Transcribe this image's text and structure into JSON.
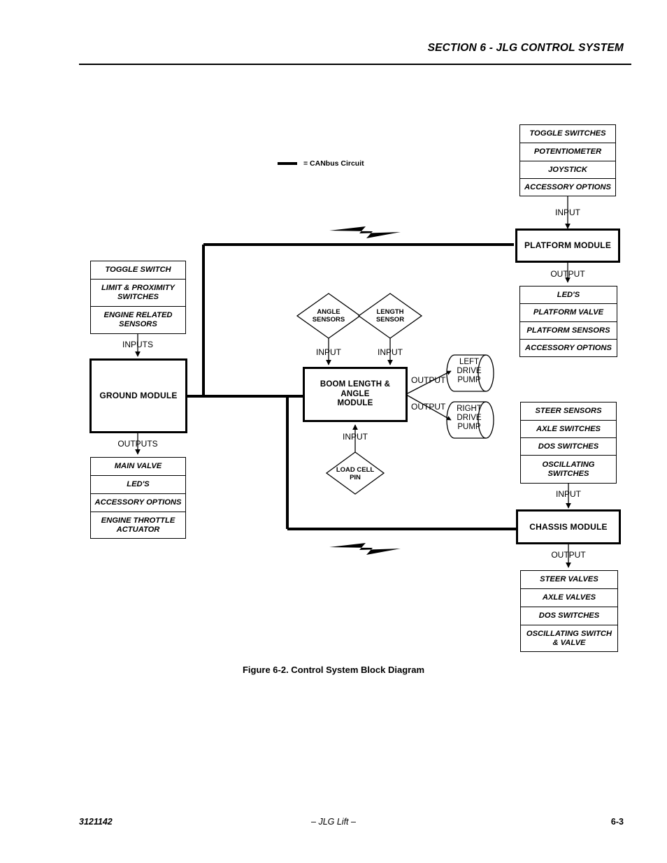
{
  "header": {
    "section_title": "SECTION 6 - JLG CONTROL SYSTEM"
  },
  "footer": {
    "doc_number": "3121142",
    "center": "– JLG Lift –",
    "page_number": "6-3"
  },
  "caption": {
    "text": "Figure 6-2.  Control System Block Diagram"
  },
  "legend": {
    "label": "= CANbus Circuit"
  },
  "flow_labels": {
    "platform_input": "INPUT",
    "platform_output": "OUTPUT",
    "ground_inputs": "INPUTS",
    "ground_outputs": "OUTPUTS",
    "angle_input": "INPUT",
    "length_input": "INPUT",
    "loadcell_input": "INPUT",
    "left_pump_output": "OUTPUT",
    "right_pump_output": "OUTPUT",
    "chassis_input": "INPUT",
    "chassis_output": "OUTPUT"
  },
  "modules": {
    "platform": "PLATFORM MODULE",
    "ground": "GROUND MODULE",
    "boom": "BOOM LENGTH & ANGLE\nMODULE",
    "boom_line1": "BOOM LENGTH & ANGLE",
    "boom_line2": "MODULE",
    "chassis": "CHASSIS MODULE"
  },
  "diamonds": {
    "angle_line1": "ANGLE",
    "angle_line2": "SENSORS",
    "length_line1": "LENGTH",
    "length_line2": "SENSOR",
    "loadcell_line1": "LOAD CELL",
    "loadcell_line2": "PIN"
  },
  "pumps": {
    "left_line1": "LEFT",
    "left_line2": "DRIVE",
    "left_line3": "PUMP",
    "right_line1": "RIGHT",
    "right_line2": "DRIVE",
    "right_line3": "PUMP"
  },
  "stacks": {
    "platform_inputs": [
      "TOGGLE SWITCHES",
      "POTENTIOMETER",
      "JOYSTICK",
      "ACCESSORY OPTIONS"
    ],
    "platform_outputs": [
      "LED'S",
      "PLATFORM VALVE",
      "PLATFORM SENSORS",
      "ACCESSORY OPTIONS"
    ],
    "ground_inputs": [
      "TOGGLE SWITCH",
      "LIMIT & PROXIMITY SWITCHES",
      "ENGINE RELATED SENSORS"
    ],
    "ground_outputs": [
      "MAIN VALVE",
      "LED'S",
      "ACCESSORY OPTIONS",
      "ENGINE THROTTLE ACTUATOR"
    ],
    "chassis_inputs": [
      "STEER SENSORS",
      "AXLE SWITCHES",
      "DOS SWITCHES",
      "OSCILLATING SWITCHES"
    ],
    "chassis_outputs": [
      "STEER VALVES",
      "AXLE VALVES",
      "DOS SWITCHES",
      "OSCILLATING SWITCH & VALVE"
    ]
  },
  "colors": {
    "ink": "#000000",
    "paper": "#ffffff"
  }
}
